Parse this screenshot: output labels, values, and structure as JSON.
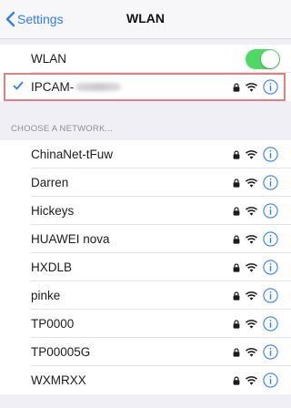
{
  "navbar": {
    "back_label": "Settings",
    "title": "WLAN"
  },
  "wlan_toggle": {
    "label": "WLAN",
    "state": "on"
  },
  "connected_network": {
    "name": "IPCAM-"
  },
  "section_header": "CHOOSE A NETWORK...",
  "networks": [
    {
      "name": "ChinaNet-tFuw"
    },
    {
      "name": "Darren"
    },
    {
      "name": "Hickeys"
    },
    {
      "name": "HUAWEI nova"
    },
    {
      "name": "HXDLB"
    },
    {
      "name": "pinke"
    },
    {
      "name": "TP0000"
    },
    {
      "name": "TP00005G"
    },
    {
      "name": "WXMRXX"
    }
  ],
  "colors": {
    "accent": "#2f7cf6",
    "toggle_on": "#4cd964",
    "highlight_border": "#e47f7f",
    "background": "#f0eff5"
  },
  "icons": [
    "chevron-left-icon",
    "checkmark-icon",
    "lock-icon",
    "wifi-icon",
    "info-icon"
  ]
}
